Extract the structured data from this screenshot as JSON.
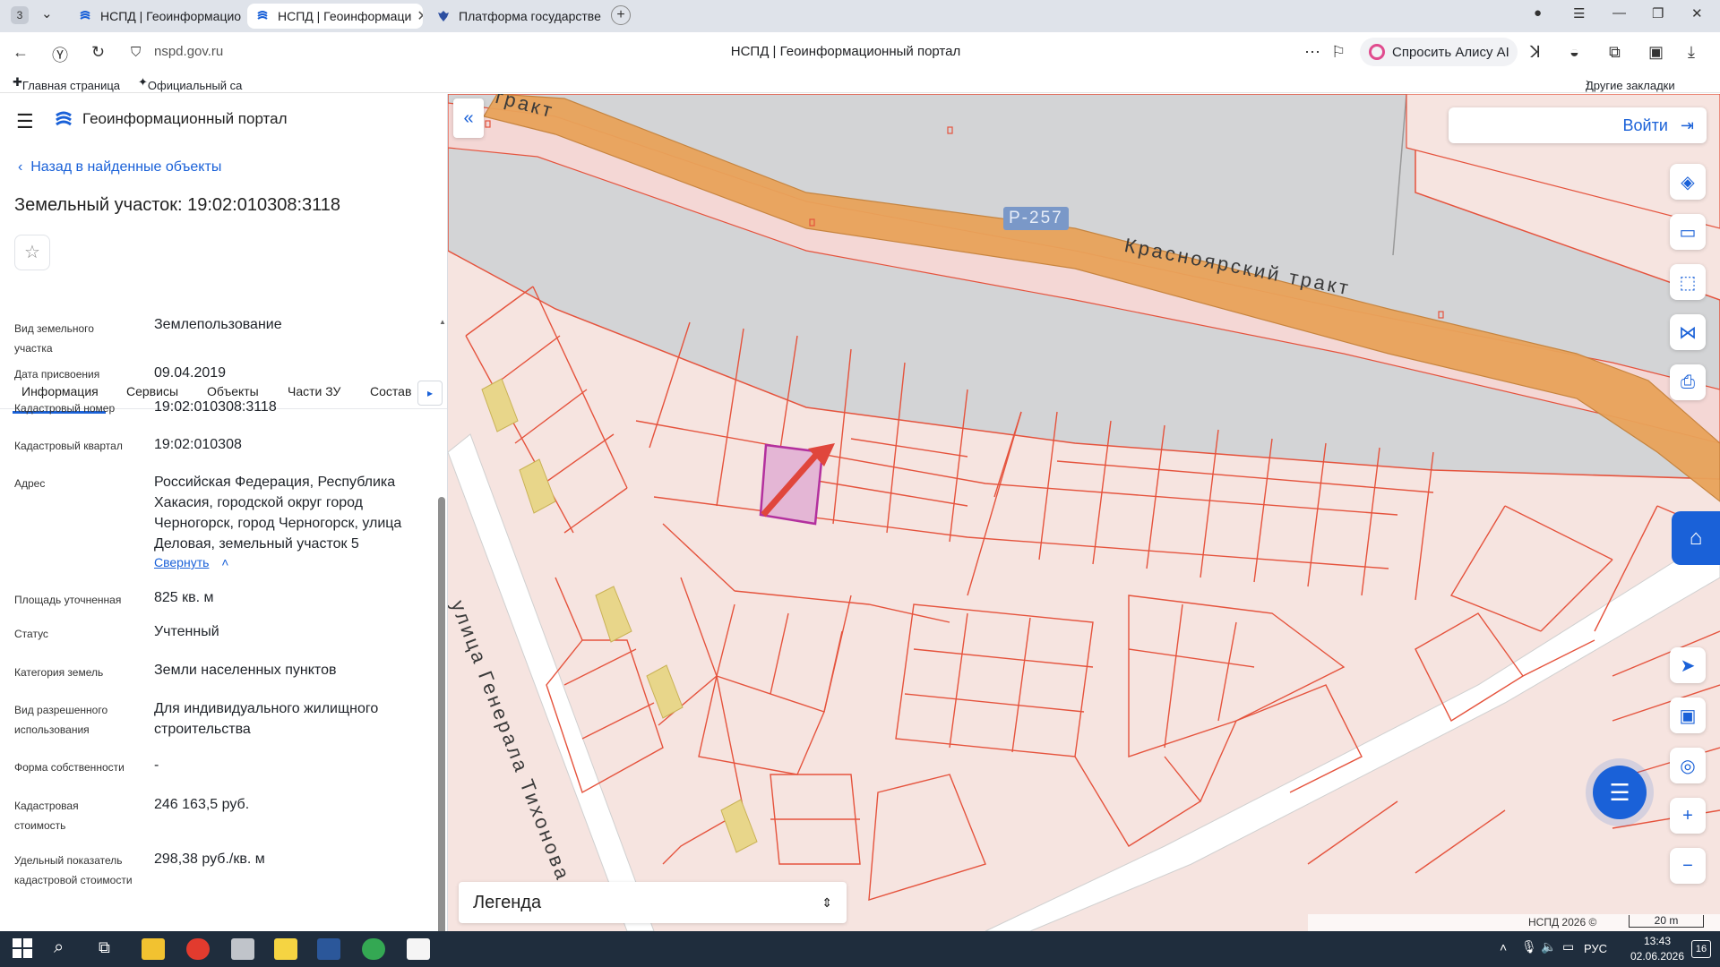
{
  "browser": {
    "tab_counter": "3",
    "tabs": [
      {
        "label": "НСПД | Геоинформацион"
      },
      {
        "label": "НСПД | Геоинформаци"
      },
      {
        "label": "Платформа государстве"
      }
    ],
    "url": "nspd.gov.ru",
    "page_title": "НСПД | Геоинформационный портал",
    "alice_button": "Спросить Алису AI",
    "bookmarks": [
      "Главная страница",
      "Официальный са"
    ],
    "other_bookmarks": "Другие закладки"
  },
  "panel": {
    "portal_title": "Геоинформационный портал",
    "back_link": "Назад в найденные объекты",
    "object_title": "Земельный участок: 19:02:010308:3118",
    "tabs": [
      "Информация",
      "Сервисы",
      "Объекты",
      "Части ЗУ",
      "Состав"
    ],
    "partial_label": "Вид земельного участка",
    "partial_value": "Землепользование",
    "rows": [
      {
        "label": "Дата присвоения",
        "value": "09.04.2019"
      },
      {
        "label": "Кадастровый номер",
        "value": "19:02:010308:3118"
      },
      {
        "label": "Кадастровый квартал",
        "value": "19:02:010308"
      },
      {
        "label": "Адрес",
        "value": "Российская Федерация, Республика Хакасия, городской округ город Черногорск, город Черногорск, улица Деловая, земельный участок 5"
      },
      {
        "label": "Площадь уточненная",
        "value": "825 кв. м"
      },
      {
        "label": "Статус",
        "value": "Учтенный"
      },
      {
        "label": "Категория земель",
        "value": "Земли населенных пунктов"
      },
      {
        "label": "Вид разрешенного использования",
        "value": "Для индивидуального жилищного строительства"
      },
      {
        "label": "Форма собственности",
        "value": "-"
      },
      {
        "label": "Кадастровая стоимость",
        "value": "246 163,5 руб."
      },
      {
        "label": "Удельный показатель кадастровой стоимости",
        "value": "298,38 руб./кв. м"
      }
    ],
    "collapse_link": "Свернуть"
  },
  "map": {
    "login_button": "Войти",
    "road_badge": "Р-257",
    "road_name": "Красноярский тракт",
    "street_name": "улица Генерала Тихонова",
    "road_partial": "тракт",
    "legend_label": "Легенда",
    "copyright": "НСПД 2026 ©",
    "scale_label": "20 m",
    "colors": {
      "parcel_line": "#e5533d",
      "parcel_fill": "#f6e4e0",
      "road": "#e9a35a",
      "selected": "#b3309e",
      "arrow": "#e0463c",
      "accent": "#1a61d8"
    }
  },
  "taskbar": {
    "lang": "РУС",
    "time": "13:43",
    "date": "02.06.2026",
    "notif_count": "16"
  }
}
